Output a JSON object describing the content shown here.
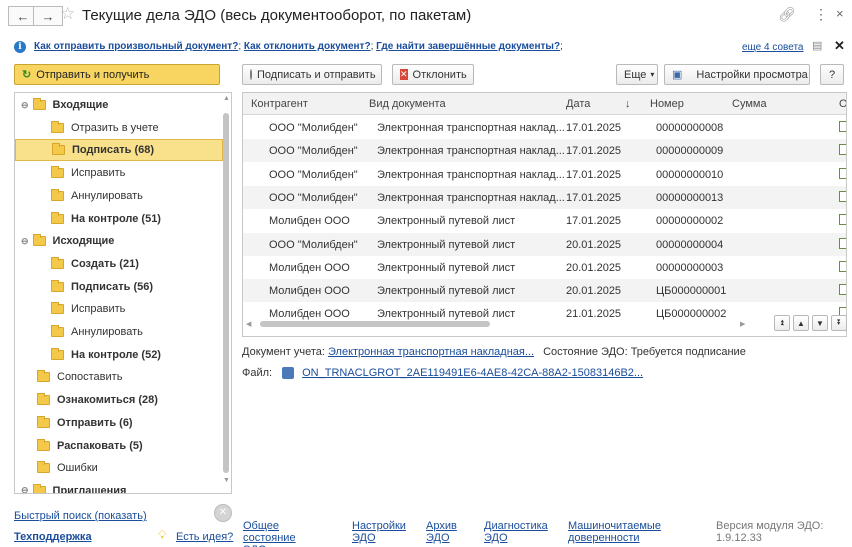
{
  "window": {
    "title": "Текущие дела ЭДО (весь документооборот, по пакетам)"
  },
  "tips": {
    "link1": "Как отправить произвольный документ?",
    "link2": "Как отклонить документ?",
    "link3": "Где найти завершённые документы?",
    "sep": ";",
    "more": "еще 4 совета"
  },
  "toolbar": {
    "send_receive": "Отправить и получить",
    "sign_send": "Подписать и отправить",
    "reject": "Отклонить",
    "more": "Еще",
    "view_settings": "Настройки просмотра",
    "help": "?"
  },
  "tree": [
    {
      "label": "Входящие",
      "bold": true,
      "level": 0,
      "group": true
    },
    {
      "label": "Отразить в учете",
      "bold": false,
      "level": 1
    },
    {
      "label": "Подписать (68)",
      "bold": true,
      "level": 1,
      "selected": true
    },
    {
      "label": "Исправить",
      "bold": false,
      "level": 1
    },
    {
      "label": "Аннулировать",
      "bold": false,
      "level": 1
    },
    {
      "label": "На контроле (51)",
      "bold": true,
      "level": 1
    },
    {
      "label": "Исходящие",
      "bold": true,
      "level": 0,
      "group": true
    },
    {
      "label": "Создать (21)",
      "bold": true,
      "level": 1
    },
    {
      "label": "Подписать (56)",
      "bold": true,
      "level": 1
    },
    {
      "label": "Исправить",
      "bold": false,
      "level": 1
    },
    {
      "label": "Аннулировать",
      "bold": false,
      "level": 1
    },
    {
      "label": "На контроле (52)",
      "bold": true,
      "level": 1
    },
    {
      "label": "Сопоставить",
      "bold": false,
      "level": 0
    },
    {
      "label": "Ознакомиться (28)",
      "bold": true,
      "level": 0
    },
    {
      "label": "Отправить (6)",
      "bold": true,
      "level": 0
    },
    {
      "label": "Распаковать (5)",
      "bold": true,
      "level": 0
    },
    {
      "label": "Ошибки",
      "bold": false,
      "level": 0
    },
    {
      "label": "Приглашения",
      "bold": true,
      "level": 0,
      "group": true
    }
  ],
  "grid": {
    "columns": {
      "counterparty": "Контрагент",
      "doc_type": "Вид документа",
      "date": "Дата",
      "sort_arrow": "↓",
      "number": "Номер",
      "sum": "Сумма",
      "extra": "О"
    },
    "rows": [
      {
        "counterparty": "ООО \"Молибден\"",
        "doc_type": "Электронная транспортная наклад...",
        "date": "17.01.2025",
        "number": "00000000008"
      },
      {
        "counterparty": "ООО \"Молибден\"",
        "doc_type": "Электронная транспортная наклад...",
        "date": "17.01.2025",
        "number": "00000000009"
      },
      {
        "counterparty": "ООО \"Молибден\"",
        "doc_type": "Электронная транспортная наклад...",
        "date": "17.01.2025",
        "number": "00000000010"
      },
      {
        "counterparty": "ООО \"Молибден\"",
        "doc_type": "Электронная транспортная наклад...",
        "date": "17.01.2025",
        "number": "00000000013"
      },
      {
        "counterparty": "Молибден ООО",
        "doc_type": "Электронный путевой лист",
        "date": "17.01.2025",
        "number": "00000000002"
      },
      {
        "counterparty": "ООО \"Молибден\"",
        "doc_type": "Электронный путевой лист",
        "date": "20.01.2025",
        "number": "00000000004"
      },
      {
        "counterparty": "Молибден ООО",
        "doc_type": "Электронный путевой лист",
        "date": "20.01.2025",
        "number": "00000000003"
      },
      {
        "counterparty": "Молибден ООО",
        "doc_type": "Электронный путевой лист",
        "date": "20.01.2025",
        "number": "ЦБ000000001"
      },
      {
        "counterparty": "Молибден ООО",
        "doc_type": "Электронный путевой лист",
        "date": "21.01.2025",
        "number": "ЦБ000000002"
      }
    ]
  },
  "details": {
    "doc_label": "Документ учета:",
    "doc_link": "Электронная транспортная накладная...",
    "state_label": "Состояние ЭДО:",
    "state_value": "Требуется подписание",
    "file_label": "Файл:",
    "file_link": "ON_TRNACLGROT_2AE119491E6-4AE8-42CA-88A2-15083146B2..."
  },
  "footer": {
    "quick_search": "Быстрый поиск (показать)",
    "support": "Техподдержка",
    "idea": "Есть идея?",
    "general_state": "Общее состояние ЭДО",
    "settings": "Настройки ЭДО",
    "archive": "Архив ЭДО",
    "diagnostics": "Диагностика ЭДО",
    "power_of_attorney": "Машиночитаемые доверенности",
    "version_label": "Версия модуля ЭДО:",
    "version": "1.9.12.33"
  }
}
